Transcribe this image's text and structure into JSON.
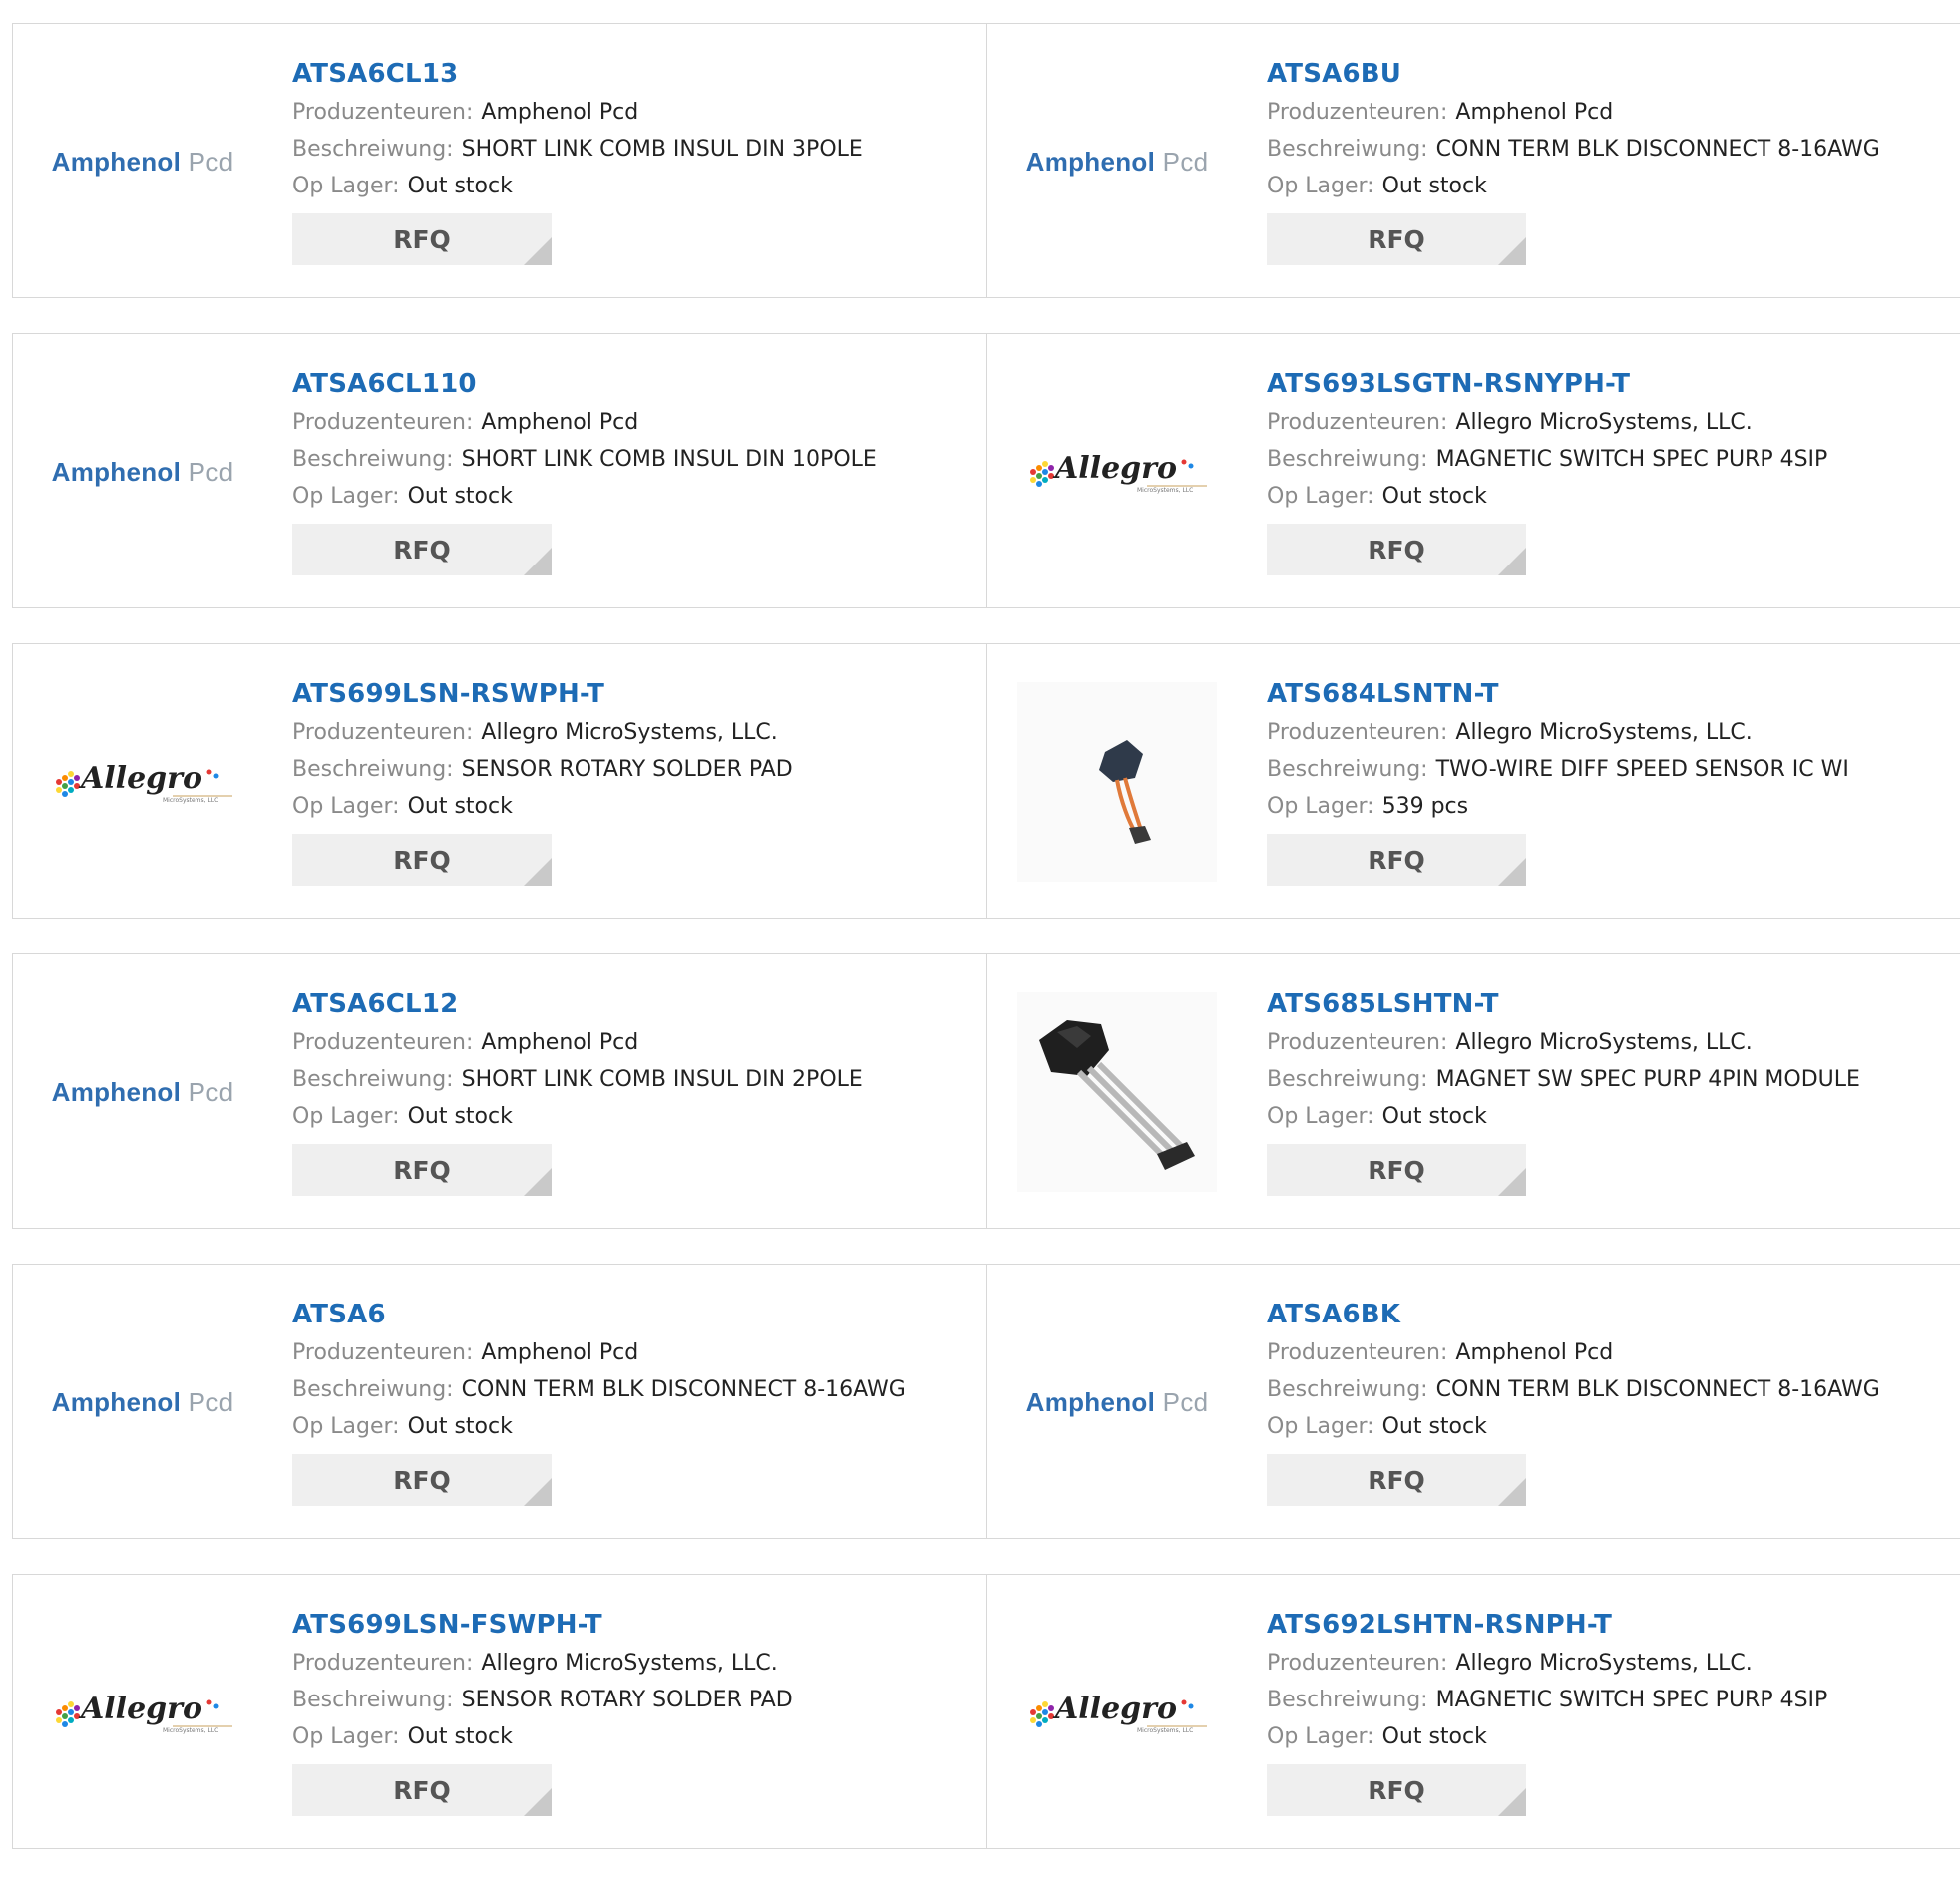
{
  "labels": {
    "manufacturer": "Produzenteuren:",
    "description": "Beschreiwung:",
    "stock": "Op Lager:",
    "rfq": "RFQ"
  },
  "logos": {
    "amphenol_part1": "Amphenol",
    "amphenol_part2": "Pcd",
    "allegro_word": "Allegro",
    "allegro_sub": "MicroSystems, LLC"
  },
  "products": [
    {
      "part": "ATSA6CL13",
      "manufacturer": "Amphenol Pcd",
      "description": "SHORT LINK COMB INSUL DIN 3POLE",
      "stock": "Out stock",
      "logo": "amphenol"
    },
    {
      "part": "ATSA6BU",
      "manufacturer": "Amphenol Pcd",
      "description": "CONN TERM BLK DISCONNECT 8-16AWG",
      "stock": "Out stock",
      "logo": "amphenol"
    },
    {
      "part": "ATSA6CL110",
      "manufacturer": "Amphenol Pcd",
      "description": "SHORT LINK COMB INSUL DIN 10POLE",
      "stock": "Out stock",
      "logo": "amphenol"
    },
    {
      "part": "ATS693LSGTN-RSNYPH-T",
      "manufacturer": "Allegro MicroSystems, LLC.",
      "description": "MAGNETIC SWITCH SPEC PURP 4SIP",
      "stock": "Out stock",
      "logo": "allegro"
    },
    {
      "part": "ATS699LSN-RSWPH-T",
      "manufacturer": "Allegro MicroSystems, LLC.",
      "description": "SENSOR ROTARY SOLDER PAD",
      "stock": "Out stock",
      "logo": "allegro"
    },
    {
      "part": "ATS684LSNTN-T",
      "manufacturer": "Allegro MicroSystems, LLC.",
      "description": "TWO-WIRE DIFF SPEED SENSOR IC WI",
      "stock": "539 pcs",
      "logo": "sensor-small"
    },
    {
      "part": "ATSA6CL12",
      "manufacturer": "Amphenol Pcd",
      "description": "SHORT LINK COMB INSUL DIN 2POLE",
      "stock": "Out stock",
      "logo": "amphenol"
    },
    {
      "part": "ATS685LSHTN-T",
      "manufacturer": "Allegro MicroSystems, LLC.",
      "description": "MAGNET SW SPEC PURP 4PIN MODULE",
      "stock": "Out stock",
      "logo": "sensor-large"
    },
    {
      "part": "ATSA6",
      "manufacturer": "Amphenol Pcd",
      "description": "CONN TERM BLK DISCONNECT 8-16AWG",
      "stock": "Out stock",
      "logo": "amphenol"
    },
    {
      "part": "ATSA6BK",
      "manufacturer": "Amphenol Pcd",
      "description": "CONN TERM BLK DISCONNECT 8-16AWG",
      "stock": "Out stock",
      "logo": "amphenol"
    },
    {
      "part": "ATS699LSN-FSWPH-T",
      "manufacturer": "Allegro MicroSystems, LLC.",
      "description": "SENSOR ROTARY SOLDER PAD",
      "stock": "Out stock",
      "logo": "allegro"
    },
    {
      "part": "ATS692LSHTN-RSNPH-T",
      "manufacturer": "Allegro MicroSystems, LLC.",
      "description": "MAGNETIC SWITCH SPEC PURP 4SIP",
      "stock": "Out stock",
      "logo": "allegro"
    }
  ]
}
